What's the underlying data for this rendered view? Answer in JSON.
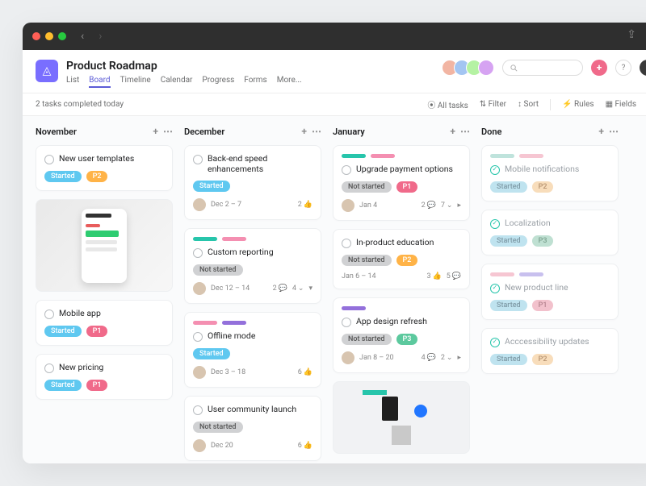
{
  "project": {
    "title": "Product Roadmap"
  },
  "tabs": {
    "list": "List",
    "board": "Board",
    "timeline": "Timeline",
    "calendar": "Calendar",
    "progress": "Progress",
    "forms": "Forms",
    "more": "More..."
  },
  "toolbar": {
    "status": "2 tasks completed today",
    "all_tasks": "All tasks",
    "filter": "Filter",
    "sort": "Sort",
    "rules": "Rules",
    "fields": "Fields"
  },
  "columns": {
    "c0": {
      "title": "November"
    },
    "c1": {
      "title": "December"
    },
    "c2": {
      "title": "January"
    },
    "c3": {
      "title": "Done"
    }
  },
  "cards": {
    "n1": {
      "title": "New user templates",
      "status": "Started",
      "priority": "P2"
    },
    "n2": {
      "title": "Mobile app",
      "status": "Started",
      "priority": "P1"
    },
    "n3": {
      "title": "New pricing",
      "status": "Started",
      "priority": "P1"
    },
    "d1": {
      "title": "Back-end speed enhancements",
      "status": "Started",
      "date": "Dec 2 – 7",
      "likes": "2"
    },
    "d2": {
      "title": "Custom reporting",
      "status": "Not started",
      "date": "Dec 12 – 14",
      "comments": "2",
      "subtasks": "4"
    },
    "d3": {
      "title": "Offline mode",
      "status": "Started",
      "date": "Dec 3 – 18",
      "likes": "6"
    },
    "d4": {
      "title": "User community launch",
      "status": "Not started",
      "date": "Dec 20",
      "likes": "6"
    },
    "j1": {
      "title": "Upgrade payment options",
      "status": "Not started",
      "priority": "P1",
      "date": "Jan 4",
      "comments": "2",
      "subtasks": "7"
    },
    "j2": {
      "title": "In-product education",
      "status": "Not started",
      "priority": "P2",
      "date": "Jan 6 – 14",
      "likes": "3",
      "comments": "5"
    },
    "j3": {
      "title": "App design refresh",
      "status": "Not started",
      "priority": "P3",
      "date": "Jan 8 – 20",
      "comments": "4",
      "subtasks": "2"
    },
    "done1": {
      "title": "Mobile notifications",
      "status": "Started",
      "priority": "P2"
    },
    "done2": {
      "title": "Localization",
      "status": "Started",
      "priority": "P3"
    },
    "done3": {
      "title": "New product line",
      "status": "Started",
      "priority": "P1"
    },
    "done4": {
      "title": "Acccessibility updates",
      "status": "Started",
      "priority": "P2"
    }
  }
}
